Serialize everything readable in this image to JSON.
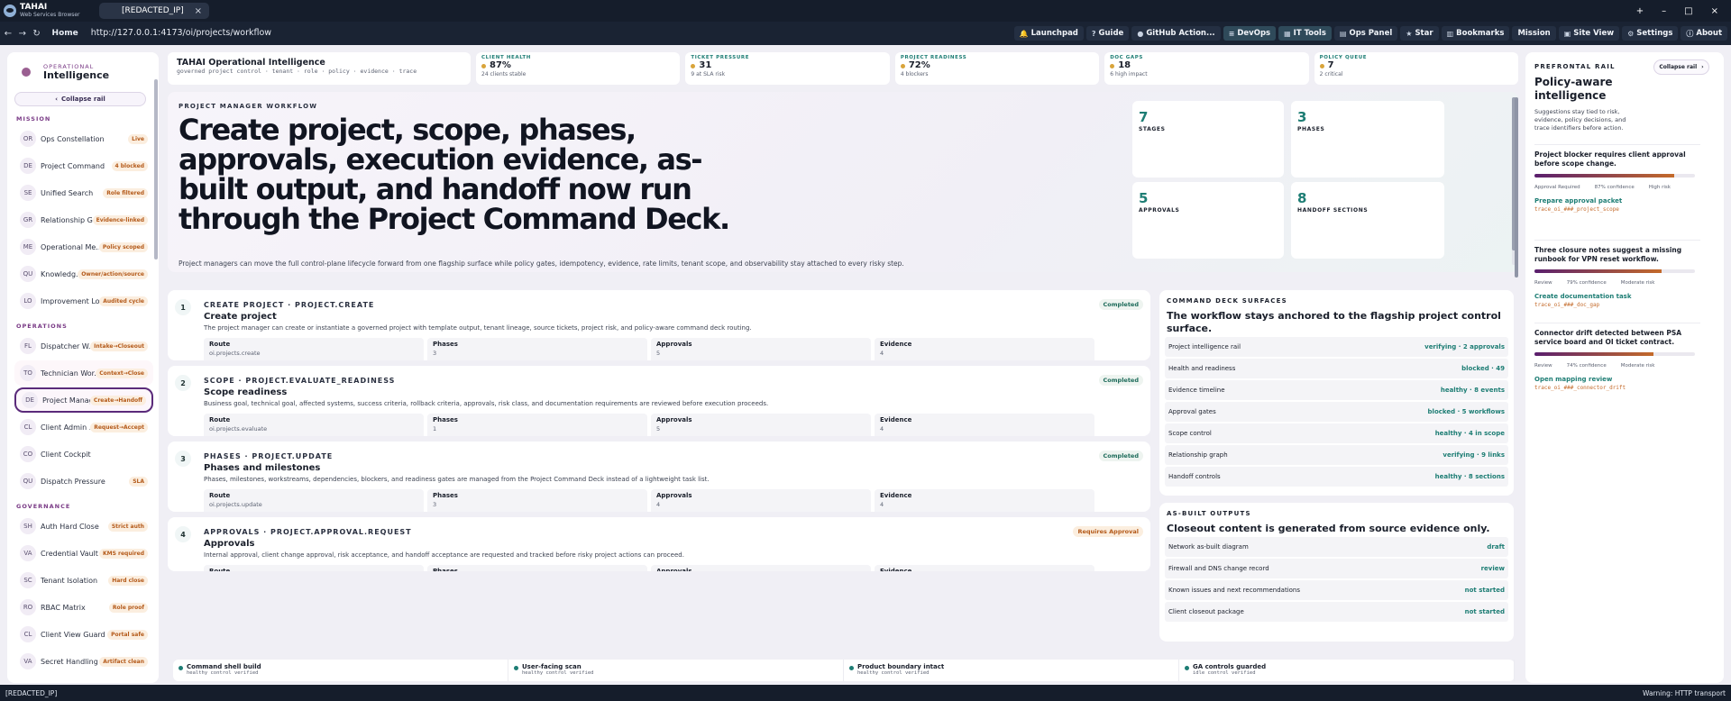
{
  "browser": {
    "brand_name": "TAHAI",
    "brand_sub": "Web Services Browser",
    "tab_title": "[REDACTED_IP]",
    "tab_close": "×",
    "home": "Home",
    "url": "http://127.0.0.1:4173/oi/projects/workflow",
    "minimize": "–",
    "maximize": "□",
    "close": "×",
    "new_tab": "+"
  },
  "toolbar": [
    {
      "label": "Launchpad",
      "icon": "bell-icon"
    },
    {
      "label": "Guide",
      "icon": "help-icon"
    },
    {
      "label": "GitHub Action...",
      "icon": "github-icon"
    },
    {
      "label": "DevOps",
      "icon": "menu-icon"
    },
    {
      "label": "IT Tools",
      "icon": "grid-icon"
    },
    {
      "label": "Ops Panel",
      "icon": "panel-icon"
    },
    {
      "label": "Star",
      "icon": "star-icon"
    },
    {
      "label": "Bookmarks",
      "icon": "bookmark-icon"
    },
    {
      "label": "Mission",
      "icon": ""
    },
    {
      "label": "Site View",
      "icon": "window-icon"
    },
    {
      "label": "Settings",
      "icon": "gear-icon"
    },
    {
      "label": "About",
      "icon": "info-icon"
    }
  ],
  "sidebar": {
    "kicker": "OPERATIONAL",
    "title": "Intelligence",
    "collapse": "Collapse rail",
    "sections": [
      {
        "title": "MISSION",
        "items": [
          {
            "abbr": "OR",
            "label": "Ops Constellation",
            "badge": "Live"
          },
          {
            "abbr": "DE",
            "label": "Project Command",
            "badge": "4 blocked"
          },
          {
            "abbr": "SE",
            "label": "Unified Search",
            "badge": "Role filtered"
          },
          {
            "abbr": "GR",
            "label": "Relationship Gr...",
            "badge": "Evidence-linked"
          },
          {
            "abbr": "ME",
            "label": "Operational Me...",
            "badge": "Policy scoped"
          },
          {
            "abbr": "QU",
            "label": "Knowledg...",
            "badge": "Owner/action/source"
          },
          {
            "abbr": "LO",
            "label": "Improvement Lo...",
            "badge": "Audited cycle"
          }
        ]
      },
      {
        "title": "OPERATIONS",
        "items": [
          {
            "abbr": "FL",
            "label": "Dispatcher W...",
            "badge": "Intake→Closeout"
          },
          {
            "abbr": "TO",
            "label": "Technician Wor...",
            "badge": "Context→Close"
          },
          {
            "abbr": "DE",
            "label": "Project Manag...",
            "badge": "Create→Handoff"
          },
          {
            "abbr": "CL",
            "label": "Client Admin ...",
            "badge": "Request→Accept"
          },
          {
            "abbr": "CO",
            "label": "Client Cockpit",
            "badge": ""
          },
          {
            "abbr": "QU",
            "label": "Dispatch Pressure",
            "badge": "SLA"
          }
        ]
      },
      {
        "title": "GOVERNANCE",
        "items": [
          {
            "abbr": "SH",
            "label": "Auth Hard Close",
            "badge": "Strict auth"
          },
          {
            "abbr": "VA",
            "label": "Credential Vault",
            "badge": "KMS required"
          },
          {
            "abbr": "SC",
            "label": "Tenant Isolation",
            "badge": "Hard close"
          },
          {
            "abbr": "RO",
            "label": "RBAC Matrix",
            "badge": "Role proof"
          },
          {
            "abbr": "CL",
            "label": "Client View Guard",
            "badge": "Portal safe"
          },
          {
            "abbr": "VA",
            "label": "Secret Handling",
            "badge": "Artifact clean"
          }
        ]
      }
    ]
  },
  "kpis": {
    "title": "TAHAI Operational Intelligence",
    "subtitle": "governed project control · tenant · role · policy · evidence · trace",
    "cards": [
      {
        "label": "CLIENT HEALTH",
        "value": "87%",
        "detail": "24 clients stable"
      },
      {
        "label": "TICKET PRESSURE",
        "value": "31",
        "detail": "9 at SLA risk"
      },
      {
        "label": "PROJECT READINESS",
        "value": "72%",
        "detail": "4 blockers"
      },
      {
        "label": "DOC GAPS",
        "value": "18",
        "detail": "6 high impact"
      },
      {
        "label": "POLICY QUEUE",
        "value": "7",
        "detail": "2 critical"
      }
    ]
  },
  "hero": {
    "kicker": "PROJECT MANAGER WORKFLOW",
    "headline": "Create project, scope, phases, approvals, execution evidence, as-built output, and handoff now run through the Project Command Deck.",
    "description": "Project managers can move the full control-plane lifecycle forward from one flagship surface while policy gates, idempotency, evidence, rate limits, tenant scope, and observability stay attached to every risky step.",
    "stats": [
      {
        "value": "7",
        "label": "STAGES"
      },
      {
        "value": "3",
        "label": "PHASES"
      },
      {
        "value": "5",
        "label": "APPROVALS"
      },
      {
        "value": "8",
        "label": "HANDOFF SECTIONS"
      }
    ]
  },
  "steps": [
    {
      "num": "1",
      "kicker": "CREATE PROJECT · PROJECT.CREATE",
      "title": "Create project",
      "desc": "The project manager can create or instantiate a governed project with template output, tenant lineage, source tickets, project risk, and policy-aware command deck routing.",
      "badge": "Completed",
      "fields": [
        {
          "label": "Route",
          "value": "oi.projects.create"
        },
        {
          "label": "Phases",
          "value": "3"
        },
        {
          "label": "Approvals",
          "value": "5"
        },
        {
          "label": "Evidence",
          "value": "4"
        }
      ]
    },
    {
      "num": "2",
      "kicker": "SCOPE · PROJECT.EVALUATE_READINESS",
      "title": "Scope readiness",
      "desc": "Business goal, technical goal, affected systems, success criteria, rollback criteria, approvals, risk class, and documentation requirements are reviewed before execution proceeds.",
      "badge": "Completed",
      "fields": [
        {
          "label": "Route",
          "value": "oi.projects.evaluate"
        },
        {
          "label": "Phases",
          "value": "1"
        },
        {
          "label": "Approvals",
          "value": "5"
        },
        {
          "label": "Evidence",
          "value": "4"
        }
      ]
    },
    {
      "num": "3",
      "kicker": "PHASES · PROJECT.UPDATE",
      "title": "Phases and milestones",
      "desc": "Phases, milestones, workstreams, dependencies, blockers, and readiness gates are managed from the Project Command Deck instead of a lightweight task list.",
      "badge": "Completed",
      "fields": [
        {
          "label": "Route",
          "value": "oi.projects.update"
        },
        {
          "label": "Phases",
          "value": "3"
        },
        {
          "label": "Approvals",
          "value": "4"
        },
        {
          "label": "Evidence",
          "value": "4"
        }
      ]
    },
    {
      "num": "4",
      "kicker": "APPROVALS · PROJECT.APPROVAL.REQUEST",
      "title": "Approvals",
      "desc": "Internal approval, client change approval, risk acceptance, and handoff acceptance are requested and tracked before risky project actions can proceed.",
      "badge": "Requires Approval",
      "fields": [
        {
          "label": "Route",
          "value": ""
        },
        {
          "label": "Phases",
          "value": ""
        },
        {
          "label": "Approvals",
          "value": ""
        },
        {
          "label": "Evidence",
          "value": ""
        }
      ]
    }
  ],
  "surfaces": {
    "kicker": "COMMAND DECK SURFACES",
    "title": "The workflow stays anchored to the flagship project control surface.",
    "rows": [
      {
        "name": "Project intelligence rail",
        "status": "verifying · 2 approvals"
      },
      {
        "name": "Health and readiness",
        "status": "blocked · 49"
      },
      {
        "name": "Evidence timeline",
        "status": "healthy · 8 events"
      },
      {
        "name": "Approval gates",
        "status": "blocked · 5 workflows"
      },
      {
        "name": "Scope control",
        "status": "healthy · 4 in scope"
      },
      {
        "name": "Relationship graph",
        "status": "verifying · 9 links"
      },
      {
        "name": "Handoff controls",
        "status": "healthy · 8 sections"
      }
    ]
  },
  "asbuilt": {
    "kicker": "AS-BUILT OUTPUTS",
    "title": "Closeout content is generated from source evidence only.",
    "rows": [
      {
        "name": "Network as-built diagram",
        "status": "draft"
      },
      {
        "name": "Firewall and DNS change record",
        "status": "review"
      },
      {
        "name": "Known issues and next recommendations",
        "status": "not started"
      },
      {
        "name": "Client closeout package",
        "status": "not started"
      }
    ]
  },
  "footer": [
    {
      "title": "Command shell build",
      "sub": "healthy control verified"
    },
    {
      "title": "User-facing scan",
      "sub": "healthy control verified"
    },
    {
      "title": "Product boundary intact",
      "sub": "healthy control verified"
    },
    {
      "title": "GA controls guarded",
      "sub": "idle control verified"
    }
  ],
  "rail": {
    "kicker": "PREFRONTAL RAIL",
    "title": "Policy-aware intelligence",
    "desc": "Suggestions stay tied to risk, evidence, policy decisions, and trace identifiers before action.",
    "collapse": "Collapse rail",
    "cards": [
      {
        "title": "Project blocker requires client approval before scope change.",
        "confidence_fraction": 0.87,
        "meta": [
          "Approval Required",
          "87% confidence",
          "High risk"
        ],
        "link": "Prepare approval packet",
        "trace": "trace_oi_###_project_scope"
      },
      {
        "title": "Three closure notes suggest a missing runbook for VPN reset workflow.",
        "confidence_fraction": 0.79,
        "meta": [
          "Review",
          "79% confidence",
          "Moderate risk"
        ],
        "link": "Create documentation task",
        "trace": "trace_oi_###_doc_gap"
      },
      {
        "title": "Connector drift detected between PSA service board and OI ticket contract.",
        "confidence_fraction": 0.74,
        "meta": [
          "Review",
          "74% confidence",
          "Moderate risk"
        ],
        "link": "Open mapping review",
        "trace": "trace_oi_###_connector_drift"
      }
    ]
  },
  "status": {
    "left": "[REDACTED_IP]",
    "right": "Warning: HTTP transport"
  }
}
